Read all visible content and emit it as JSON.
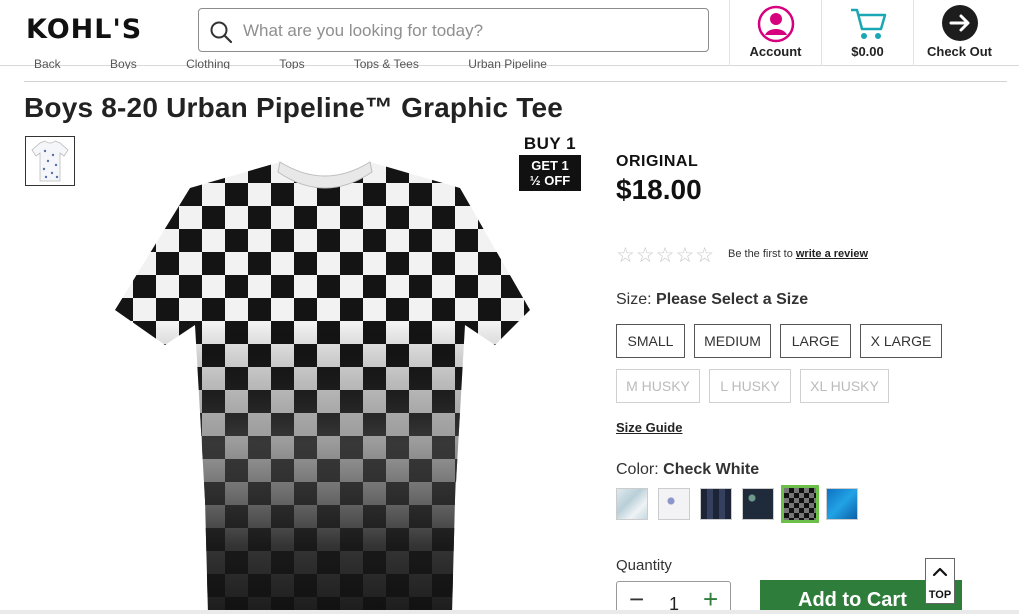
{
  "header": {
    "logo": "KOHL'S",
    "search_placeholder": "What are you looking for today?",
    "account_label": "Account",
    "cart_label": "$0.00",
    "checkout_label": "Check Out"
  },
  "breadcrumb": [
    "Back",
    "Boys",
    "Clothing",
    "Tops",
    "Tops & Tees",
    "Urban Pipeline"
  ],
  "product": {
    "title": "Boys 8-20 Urban Pipeline™ Graphic Tee",
    "promo_top": "BUY 1",
    "promo_line1": "GET 1",
    "promo_line2": "½ OFF",
    "price_label": "ORIGINAL",
    "price": "$18.00",
    "stars": "☆☆☆☆☆",
    "review_prefix": "Be the first to",
    "review_link": "write a review",
    "size_label": "Size:",
    "size_value": "Please Select a Size",
    "sizes": [
      "SMALL",
      "MEDIUM",
      "LARGE",
      "X LARGE"
    ],
    "sizes_unavailable": [
      "M HUSKY",
      "L HUSKY",
      "XL HUSKY"
    ],
    "size_guide": "Size Guide",
    "color_label": "Color:",
    "color_value": "Check White",
    "quantity_label": "Quantity",
    "quantity_value": "1",
    "minus": "−",
    "plus": "+",
    "add_to_cart": "Add to Cart",
    "top_label": "TOP"
  },
  "colors": {
    "brand_green": "#2f7d3b",
    "account_pink": "#d6007e",
    "cart_teal": "#1aa7b5",
    "selected_swatch": "#6cc04a"
  }
}
